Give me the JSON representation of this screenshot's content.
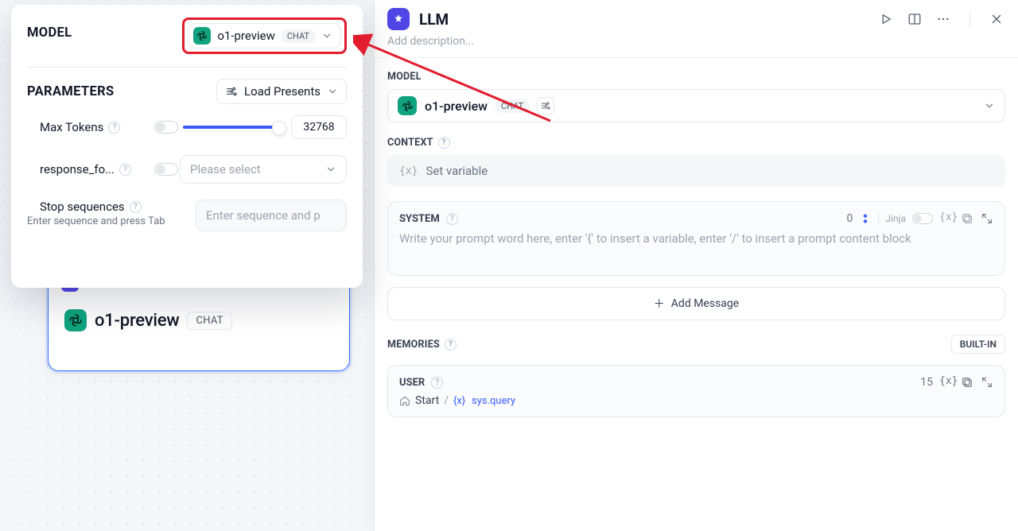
{
  "panel": {
    "model_heading": "MODEL",
    "params_heading": "PARAMETERS",
    "load_presets": "Load Presents",
    "selector": {
      "name": "o1-preview",
      "pill": "CHAT"
    },
    "max_tokens": {
      "label": "Max Tokens",
      "value": "32768"
    },
    "response_format": {
      "label": "response_fo...",
      "placeholder": "Please select"
    },
    "stop": {
      "label": "Stop sequences",
      "hint": "Enter sequence and press Tab",
      "placeholder": "Enter sequence and p"
    }
  },
  "node": {
    "model_name": "o1-preview",
    "pill": "CHAT"
  },
  "right": {
    "title": "LLM",
    "description_placeholder": "Add description...",
    "model_section": "MODEL",
    "model_name": "o1-preview",
    "model_pill": "CHAT",
    "context_section": "CONTEXT",
    "set_variable": "Set variable",
    "system": {
      "label": "SYSTEM",
      "count": "0",
      "jinja": "Jinja",
      "placeholder": "Write your prompt word here, enter '{' to insert a variable, enter '/' to insert a prompt content block"
    },
    "add_message": "Add Message",
    "memories_section": "MEMORIES",
    "builtin": "BUILT-IN",
    "user": {
      "label": "USER",
      "count": "15",
      "start": "Start",
      "sysquery_brace": "{x}",
      "sysquery": "sys.query"
    }
  },
  "colors": {
    "accent_red": "#e11d2e",
    "accent_blue": "#3b5cff",
    "openai": "#10a37f"
  }
}
